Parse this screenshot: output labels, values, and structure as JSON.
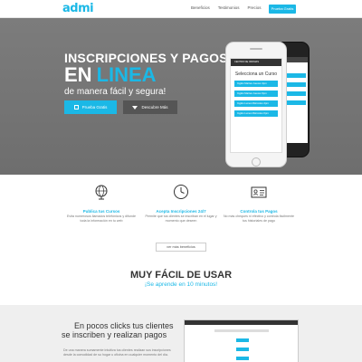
{
  "nav": {
    "logo": "admi",
    "links": [
      "Beneficios",
      "Testimonios",
      "Precios",
      "Contacto"
    ],
    "cta": "Prueba Gratis"
  },
  "hero": {
    "line1": "INSCRIPCIONES Y PAGOS",
    "line2a": "EN",
    "line2b": "LINEA",
    "subtitle": "de manera fácil y segura!",
    "btn_trial": "Prueba Gratis",
    "btn_more": "Descubre Más",
    "phone": {
      "header": "CENTRO DE IDIOMAS",
      "title": "Selecciona un Curso",
      "items": [
        "Inglés Martes Jueves 4pm",
        "Inglés Martes Jueves 6pm",
        "Inglés Lunes Miércoles 4pm",
        "Inglés Lunes Miércoles 6pm"
      ]
    }
  },
  "features": [
    {
      "icon": "globe-icon",
      "title": "Publica tus Cursos",
      "desc": "Evita numerosos llamados telefónicos y difunde toda la información en tu web"
    },
    {
      "icon": "clock-icon",
      "title": "Acepta Inscripciones 24/7",
      "desc": "Permite que tus clientes se inscriban en el lugar y momento que deseen"
    },
    {
      "icon": "id-card-icon",
      "title": "Controla tus Pagos",
      "desc": "No más cheques ni efectivo y controla fácilmente tus historiales de pago"
    }
  ],
  "more_button": "ver más beneficios",
  "easy": {
    "title": "MUY FÁCIL DE USAR",
    "subtitle": "¡Se aprende en 10 minutos!"
  },
  "bottom": {
    "line1": "En pocos clicks tus clientes",
    "line2": "se inscriben y realizan pagos",
    "desc": "De una manera sumamente intuitiva tus clientes realizan sus inscripciones desde la comodidad de su hogar u oficina en cualquier momento del día."
  },
  "colors": {
    "accent": "#1bb8e6",
    "hero_bg": "#777777",
    "dark_button": "#555555"
  }
}
